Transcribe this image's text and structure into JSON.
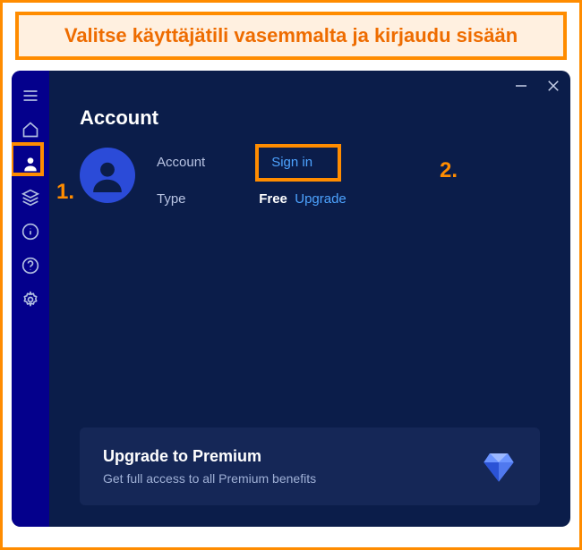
{
  "banner": {
    "text": "Valitse käyttäjätili vasemmalta ja kirjaudu sisään"
  },
  "markers": {
    "one": "1.",
    "two": "2."
  },
  "page": {
    "title": "Account",
    "account_label": "Account",
    "signin": "Sign in",
    "type_label": "Type",
    "type_value": "Free",
    "upgrade_link": "Upgrade"
  },
  "promo": {
    "title": "Upgrade to Premium",
    "subtitle": "Get full access to all Premium benefits"
  }
}
